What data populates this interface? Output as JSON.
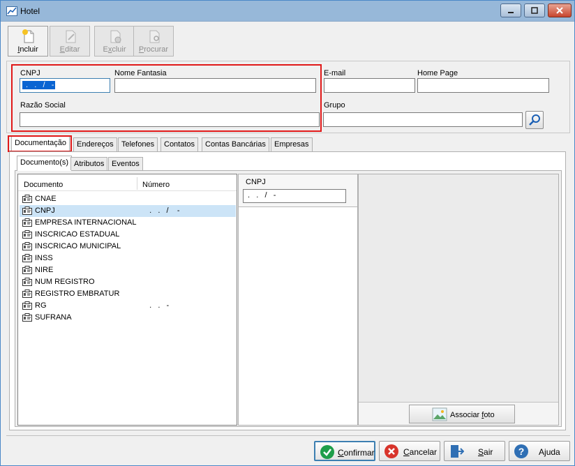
{
  "window": {
    "title": "Hotel",
    "controls": [
      "minimize",
      "maximize",
      "close"
    ]
  },
  "toolbar": {
    "buttons": [
      {
        "label": "Incluir",
        "underline": "I",
        "rest": "ncluir",
        "enabled": true,
        "icon": "new-document-icon"
      },
      {
        "label": "Editar",
        "underline": "E",
        "rest": "ditar",
        "enabled": false,
        "icon": "edit-document-icon"
      },
      {
        "label": "Excluir",
        "underline": "x",
        "rest": "cluir",
        "prefix": "E",
        "enabled": false,
        "icon": "delete-document-icon"
      },
      {
        "label": "Procurar",
        "underline": "P",
        "rest": "rocurar",
        "enabled": false,
        "icon": "find-document-icon"
      }
    ]
  },
  "form": {
    "cnpj_label": "CNPJ",
    "cnpj_value": " .   .   /   -",
    "nome_fantasia_label": "Nome Fantasia",
    "nome_fantasia_value": "",
    "email_label": "E-mail",
    "email_value": "",
    "home_page_label": "Home Page",
    "home_page_value": "",
    "razao_social_label": "Razão Social",
    "razao_social_value": "",
    "grupo_label": "Grupo",
    "grupo_value": ""
  },
  "tabs": [
    {
      "label": "Documentação",
      "active": true
    },
    {
      "label": "Endereços",
      "active": false
    },
    {
      "label": "Telefones",
      "active": false
    },
    {
      "label": "Contatos",
      "active": false
    },
    {
      "label": "Contas Bancárias",
      "active": false
    },
    {
      "label": "Empresas",
      "active": false
    }
  ],
  "subtabs": [
    {
      "label": "Documento(s)",
      "active": true
    },
    {
      "label": "Atributos",
      "active": false
    },
    {
      "label": "Eventos",
      "active": false
    }
  ],
  "documents": {
    "columns": [
      "Documento",
      "Número"
    ],
    "rows": [
      {
        "name": "CNAE",
        "number": "",
        "selected": false
      },
      {
        "name": "CNPJ",
        "number": "  .   .   /    -",
        "selected": true
      },
      {
        "name": "EMPRESA INTERNACIONAL",
        "number": "",
        "selected": false
      },
      {
        "name": "INSCRICAO ESTADUAL",
        "number": "",
        "selected": false
      },
      {
        "name": "INSCRICAO MUNICIPAL",
        "number": "",
        "selected": false
      },
      {
        "name": "INSS",
        "number": "",
        "selected": false
      },
      {
        "name": "NIRE",
        "number": "",
        "selected": false
      },
      {
        "name": "NUM REGISTRO",
        "number": "",
        "selected": false
      },
      {
        "name": "REGISTRO EMBRATUR",
        "number": "",
        "selected": false
      },
      {
        "name": "RG",
        "number": "  .   .   -",
        "selected": false
      },
      {
        "name": "SUFRANA",
        "number": "",
        "selected": false
      }
    ]
  },
  "detail": {
    "label": "CNPJ",
    "value": " .   .   /   -"
  },
  "photo": {
    "button_label": "Associar foto",
    "underline": "f"
  },
  "footer": {
    "buttons": [
      {
        "label": "Confirmar",
        "underline": "C",
        "rest": "onfirmar",
        "icon": "check-icon",
        "color": "#1e9e4a"
      },
      {
        "label": "Cancelar",
        "underline": "C",
        "rest": "ancelar",
        "icon": "cancel-icon",
        "color": "#d8342b"
      },
      {
        "label": "Sair",
        "underline": "S",
        "rest": "air",
        "icon": "exit-door-icon",
        "color": "#2f6fb4"
      },
      {
        "label": "Ajuda",
        "underline": "j",
        "prefix": "A",
        "rest": "uda",
        "icon": "help-icon",
        "color": "#2f6fb4"
      }
    ]
  },
  "colors": {
    "highlight_red": "#e01818",
    "selection_blue": "#0a64d2",
    "selected_row": "#cce4f7",
    "title_bar": "#97b8d9"
  }
}
